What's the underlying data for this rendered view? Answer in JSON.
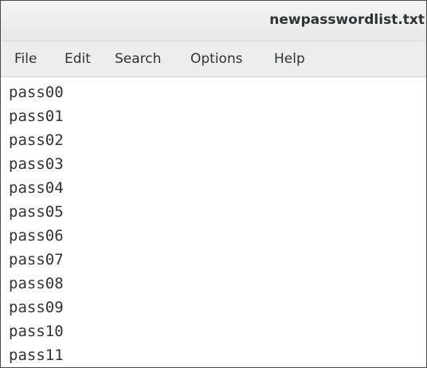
{
  "window": {
    "title": "newpasswordlist.txt"
  },
  "menubar": {
    "items": [
      "File",
      "Edit",
      "Search",
      "Options",
      "Help"
    ]
  },
  "document": {
    "lines": [
      "pass00",
      "pass01",
      "pass02",
      "pass03",
      "pass04",
      "pass05",
      "pass06",
      "pass07",
      "pass08",
      "pass09",
      "pass10",
      "pass11"
    ]
  }
}
